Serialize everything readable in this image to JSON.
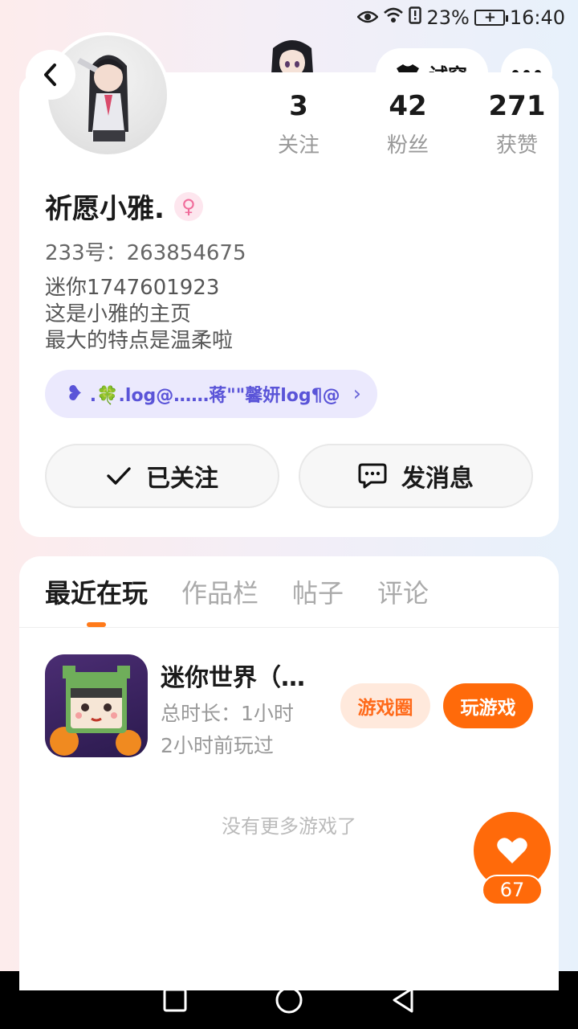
{
  "status_bar": {
    "battery": "23%",
    "time": "16:40"
  },
  "header": {
    "tryon_label": "试穿"
  },
  "profile": {
    "stats": [
      {
        "value": "3",
        "label": "关注"
      },
      {
        "value": "42",
        "label": "粉丝"
      },
      {
        "value": "271",
        "label": "获赞"
      }
    ],
    "username": "祈愿小雅.",
    "gender_symbol": "♀",
    "account_id": "233号：263854675",
    "bio": [
      "迷你1747601923",
      "这是小雅的主页",
      "最大的特点是温柔啦"
    ],
    "tag_text": ".🍀.log@……蒋\"\"馨妍log¶@",
    "follow_label": "已关注",
    "message_label": "发消息"
  },
  "tabs": [
    "最近在玩",
    "作品栏",
    "帖子",
    "评论"
  ],
  "game": {
    "title": "迷你世界（…",
    "duration": "总时长：1小时",
    "last_played": "2小时前玩过",
    "circle_label": "游戏圈",
    "play_label": "玩游戏"
  },
  "no_more_text": "没有更多游戏了",
  "like_count": "67",
  "colors": {
    "accent": "#ff6a0a",
    "tag_purple": "#5a54d8"
  }
}
